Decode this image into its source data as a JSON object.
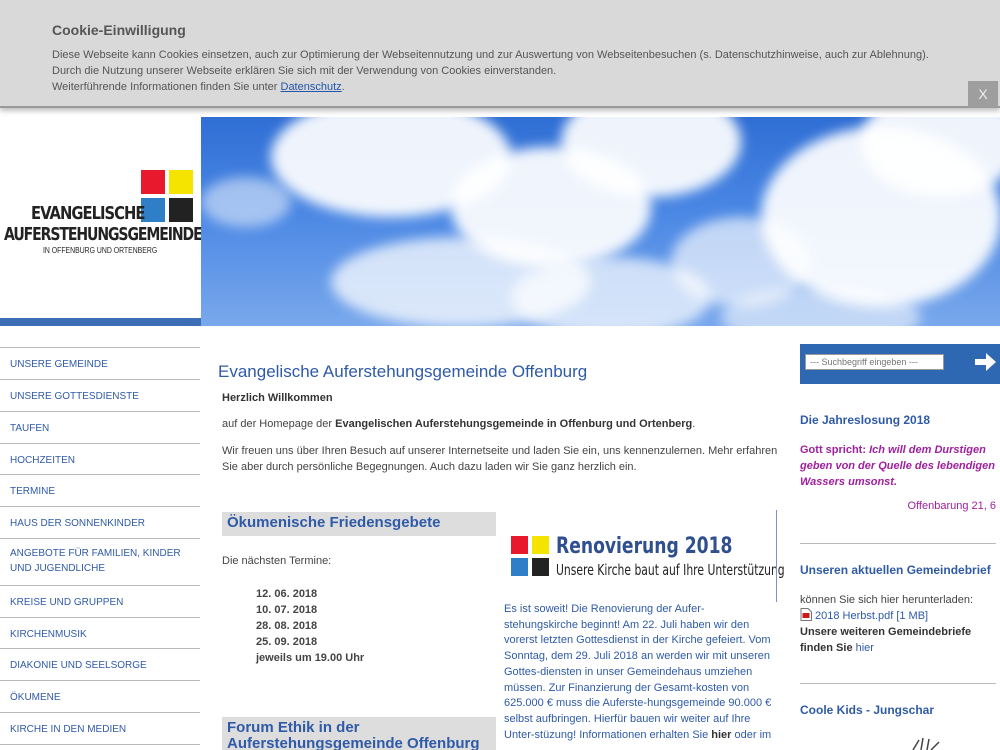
{
  "cookie": {
    "title": "Cookie-Einwilligung",
    "text_line1": "Diese Webseite kann Cookies einsetzen, auch zur Optimierung der Webseitennutzung und zur Auswertung von Webseitenbesuchen (s. Datenschutzhinweise, auch zur Ablehnung). Durch die Nutzung unserer Webseite erklären Sie sich mit der Verwendung von Cookies einverstanden.",
    "text_line2_prefix": "Weiterführende Informationen finden Sie unter ",
    "link_label": "Datenschutz",
    "text_line2_suffix": ".",
    "close_label": "X"
  },
  "logo": {
    "line1": "EVANGELISCHE",
    "line2": "AUFERSTEHUNGSGEMEINDE",
    "line3": "IN OFFENBURG UND ORTENBERG",
    "colors": [
      "#e8192c",
      "#f5e400",
      "#2f7fc8",
      "#222222"
    ]
  },
  "nav": {
    "items": [
      {
        "label": "UNSERE GEMEINDE"
      },
      {
        "label": "UNSERE GOTTESDIENSTE"
      },
      {
        "label": "TAUFEN"
      },
      {
        "label": "HOCHZEITEN"
      },
      {
        "label": "TERMINE"
      },
      {
        "label": "HAUS DER SONNENKINDER"
      },
      {
        "label": "ANGEBOTE FÜR FAMILIEN, KINDER UND JUGENDLICHE"
      },
      {
        "label": "KREISE UND GRUPPEN"
      },
      {
        "label": "KIRCHENMUSIK"
      },
      {
        "label": "DIAKONIE UND SEELSORGE"
      },
      {
        "label": "ÖKUMENE"
      },
      {
        "label": "KIRCHE IN DEN MEDIEN"
      }
    ]
  },
  "main": {
    "title": "Evangelische Auferstehungsgemeinde Offenburg",
    "welcome": "Herzlich Willkommen",
    "intro_prefix": "auf der Homepage der ",
    "intro_bold": "Evangelischen Auferstehungsgemeinde in Offenburg und Ortenberg",
    "intro_suffix": ".",
    "paragraph": "Wir freuen uns über Ihren Besuch auf unserer Internetseite und laden Sie ein, uns kennenzulernen. Mehr erfahren Sie aber durch persönliche Begegnungen. Auch dazu laden wir Sie ganz herzlich ein.",
    "box1_title": "Ökumenische Friedensgebete",
    "dates_intro": "Die nächsten Termine:",
    "dates": [
      "12. 06. 2018",
      "10. 07. 2018",
      "28. 08. 2018",
      "25. 09. 2018",
      "jeweils um 19.00 Uhr"
    ],
    "box2_title": "Forum Ethik in der Auferstehungsgemeinde Offenburg"
  },
  "renovation": {
    "banner_title": "Renovierung 2018",
    "banner_subtitle": "Unsere Kirche baut auf Ihre Unterstützung",
    "text": "Es ist soweit! Die Renovierung der Aufer-stehungskirche beginnt! Am 22. Juli haben wir den vorerst letzten Gottesdienst in der Kirche gefeiert. Vom Sonntag, dem 29. Juli 2018 an werden wir mit unseren Gottes-diensten in unser Gemeindehaus umziehen müssen. Zur Finanzierung der Gesamt-kosten von 625.000 € muss die  Auferste-hungsgemeinde 90.000 € selbst aufbringen. Hierfür bauen wir weiter auf Ihre Unter-stüzung! Informationen erhalten Sie ",
    "link_hier": "hier",
    "text_suffix": " oder im"
  },
  "sidebar": {
    "search_placeholder": "--- Suchbegriff eingeben ---",
    "jahreslosung_title": "Die Jahreslosung 2018",
    "verse_lead": "Gott spricht: ",
    "verse": "Ich will dem Durstigen geben von der Quelle des lebendigen Wassers umsonst.",
    "verse_ref": "Offenbarung 21, 6",
    "gemeindebrief_title": "Unseren aktuellen Gemeindebrief",
    "download_text": "können Sie sich hier herunterladen:",
    "pdf_label": "2018 Herbst.pdf [1 MB]",
    "more_text": "Unsere weiteren Gemeindebriefe finden Sie ",
    "more_link": "hier",
    "kids_title": "Coole Kids - Jungschar"
  }
}
